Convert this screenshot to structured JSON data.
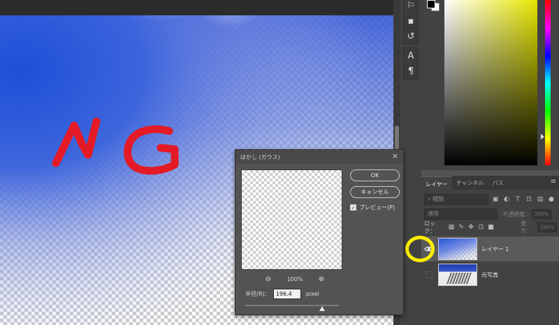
{
  "colors": {
    "blur_blue": "#1f52d8",
    "ng_red": "#e41a26",
    "highlight": "#ffef00",
    "panel_bg": "#424242",
    "dialog_bg": "#535353"
  },
  "canvas": {
    "annotation_text": "NG"
  },
  "tools": {
    "strip1": [
      "history-icon",
      "comment-icon"
    ],
    "strip2": [
      "history-brush-icon"
    ],
    "strip3": [
      "character-icon",
      "paragraph-icon"
    ],
    "glyphs": {
      "history-icon": "⚐",
      "comment-icon": "▪",
      "history-brush-icon": "↺",
      "character-icon": "A",
      "paragraph-icon": "¶"
    }
  },
  "layers_panel": {
    "tabs": [
      "レイヤー",
      "チャンネル",
      "パス"
    ],
    "menu_glyph": "≡",
    "filter_label": "種類",
    "blend_mode": "通常",
    "opacity_label": "不透明度：",
    "opacity_value": "100%",
    "lock_label": "ロック：",
    "fill_label": "塗り：",
    "fill_value": "100%",
    "layers": [
      {
        "name": "レイヤー 1",
        "visible": true,
        "selected": true
      },
      {
        "name": "元写真",
        "visible": false,
        "selected": false
      }
    ]
  },
  "dialog": {
    "title": "ぼかし (ガウス)",
    "close_glyph": "×",
    "ok_label": "OK",
    "cancel_label": "キャンセル",
    "preview_label": "プレビュー(P)",
    "preview_checked": true,
    "zoom_out_glyph": "⊖",
    "zoom_in_glyph": "⊕",
    "zoom_value": "100%",
    "radius_label": "半径(R)：",
    "radius_value": "196.4",
    "radius_unit": "pixel",
    "slider_fraction": 0.82
  }
}
